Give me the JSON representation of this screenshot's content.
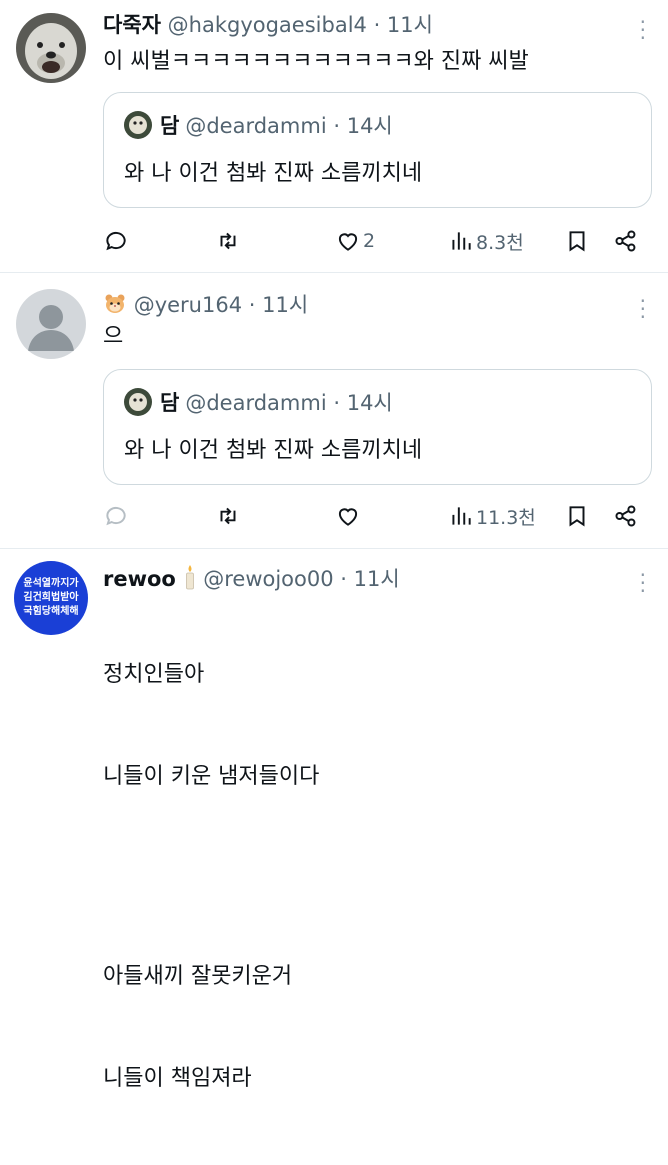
{
  "tweets": [
    {
      "name": "다죽자",
      "handle": "@hakgyogaesibal4",
      "time": "· 11시",
      "text": "이 씨벌ㅋㅋㅋㅋㅋㅋㅋㅋㅋㅋㅋㅋ와 진짜 씨발",
      "quote": {
        "name": "담",
        "handle": "@deardammi",
        "time": "· 14시",
        "text": "와 나 이건 첨봐 진짜 소름끼치네"
      },
      "likes": "2",
      "views": "8.3천"
    },
    {
      "name": "",
      "handle": "@yeru164",
      "time": "· 11시",
      "text": "으",
      "quote": {
        "name": "담",
        "handle": "@deardammi",
        "time": "· 14시",
        "text": "와 나 이건 첨봐 진짜 소름끼치네"
      },
      "likes": "",
      "views": "11.3천"
    },
    {
      "name": "rewoo",
      "handle": "@rewojoo00",
      "time": "· 11시",
      "text_lines": [
        "정치인들아",
        "니들이 키운 냄저들이다",
        "",
        "아들새끼 잘못키운거",
        "니들이 책임져라"
      ],
      "avatar_lines": [
        "윤석열까지가",
        "김건희법받아",
        "국힘당해체해"
      ]
    }
  ],
  "icons": {
    "reply": "speech-bubble-icon",
    "retweet": "retweet-icon",
    "like": "heart-icon",
    "views": "bar-chart-icon",
    "bookmark": "bookmark-icon",
    "share": "share-icon",
    "more": "more-dots-icon"
  }
}
